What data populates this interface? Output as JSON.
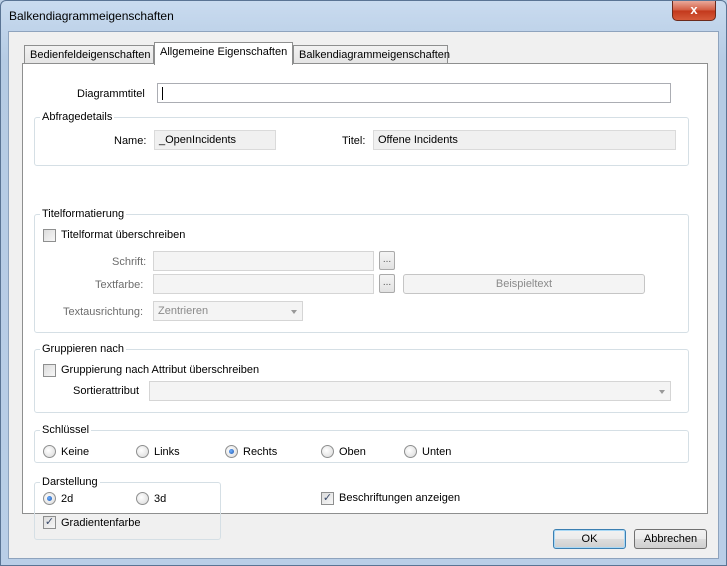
{
  "window": {
    "title": "Balkendiagrammeigenschaften",
    "close_glyph": "x"
  },
  "tabs": [
    {
      "label": "Bedienfeldeigenschaften"
    },
    {
      "label": "Allgemeine Eigenschaften"
    },
    {
      "label": "Balkendiagrammeigenschaften"
    }
  ],
  "general": {
    "chart_title_label": "Diagrammtitel",
    "chart_title_value": ""
  },
  "query": {
    "legend": "Abfragedetails",
    "name_label": "Name:",
    "name_value": "_OpenIncidents",
    "title_label": "Titel:",
    "title_value": "Offene Incidents"
  },
  "title_format": {
    "legend": "Titelformatierung",
    "override_label": "Titelformat überschreiben",
    "font_label": "Schrift:",
    "font_value": "",
    "color_label": "Textfarbe:",
    "color_value": "",
    "ellipsis": "...",
    "sample_label": "Beispieltext",
    "align_label": "Textausrichtung:",
    "align_value": "Zentrieren"
  },
  "grouping": {
    "legend": "Gruppieren nach",
    "override_label": "Gruppierung nach Attribut überschreiben",
    "sort_label": "Sortierattribut",
    "sort_value": ""
  },
  "legend_group": {
    "legend": "Schlüssel",
    "options": [
      "Keine",
      "Links",
      "Rechts",
      "Oben",
      "Unten"
    ],
    "selected": "Rechts"
  },
  "display": {
    "legend": "Darstellung",
    "opt_2d": "2d",
    "opt_3d": "3d",
    "selected": "2d",
    "gradient_label": "Gradientenfarbe",
    "gradient_checked": true,
    "labels_label": "Beschriftungen anzeigen",
    "labels_checked": true,
    "check_glyph": "✓"
  },
  "buttons": {
    "ok": "OK",
    "cancel": "Abbrechen"
  }
}
